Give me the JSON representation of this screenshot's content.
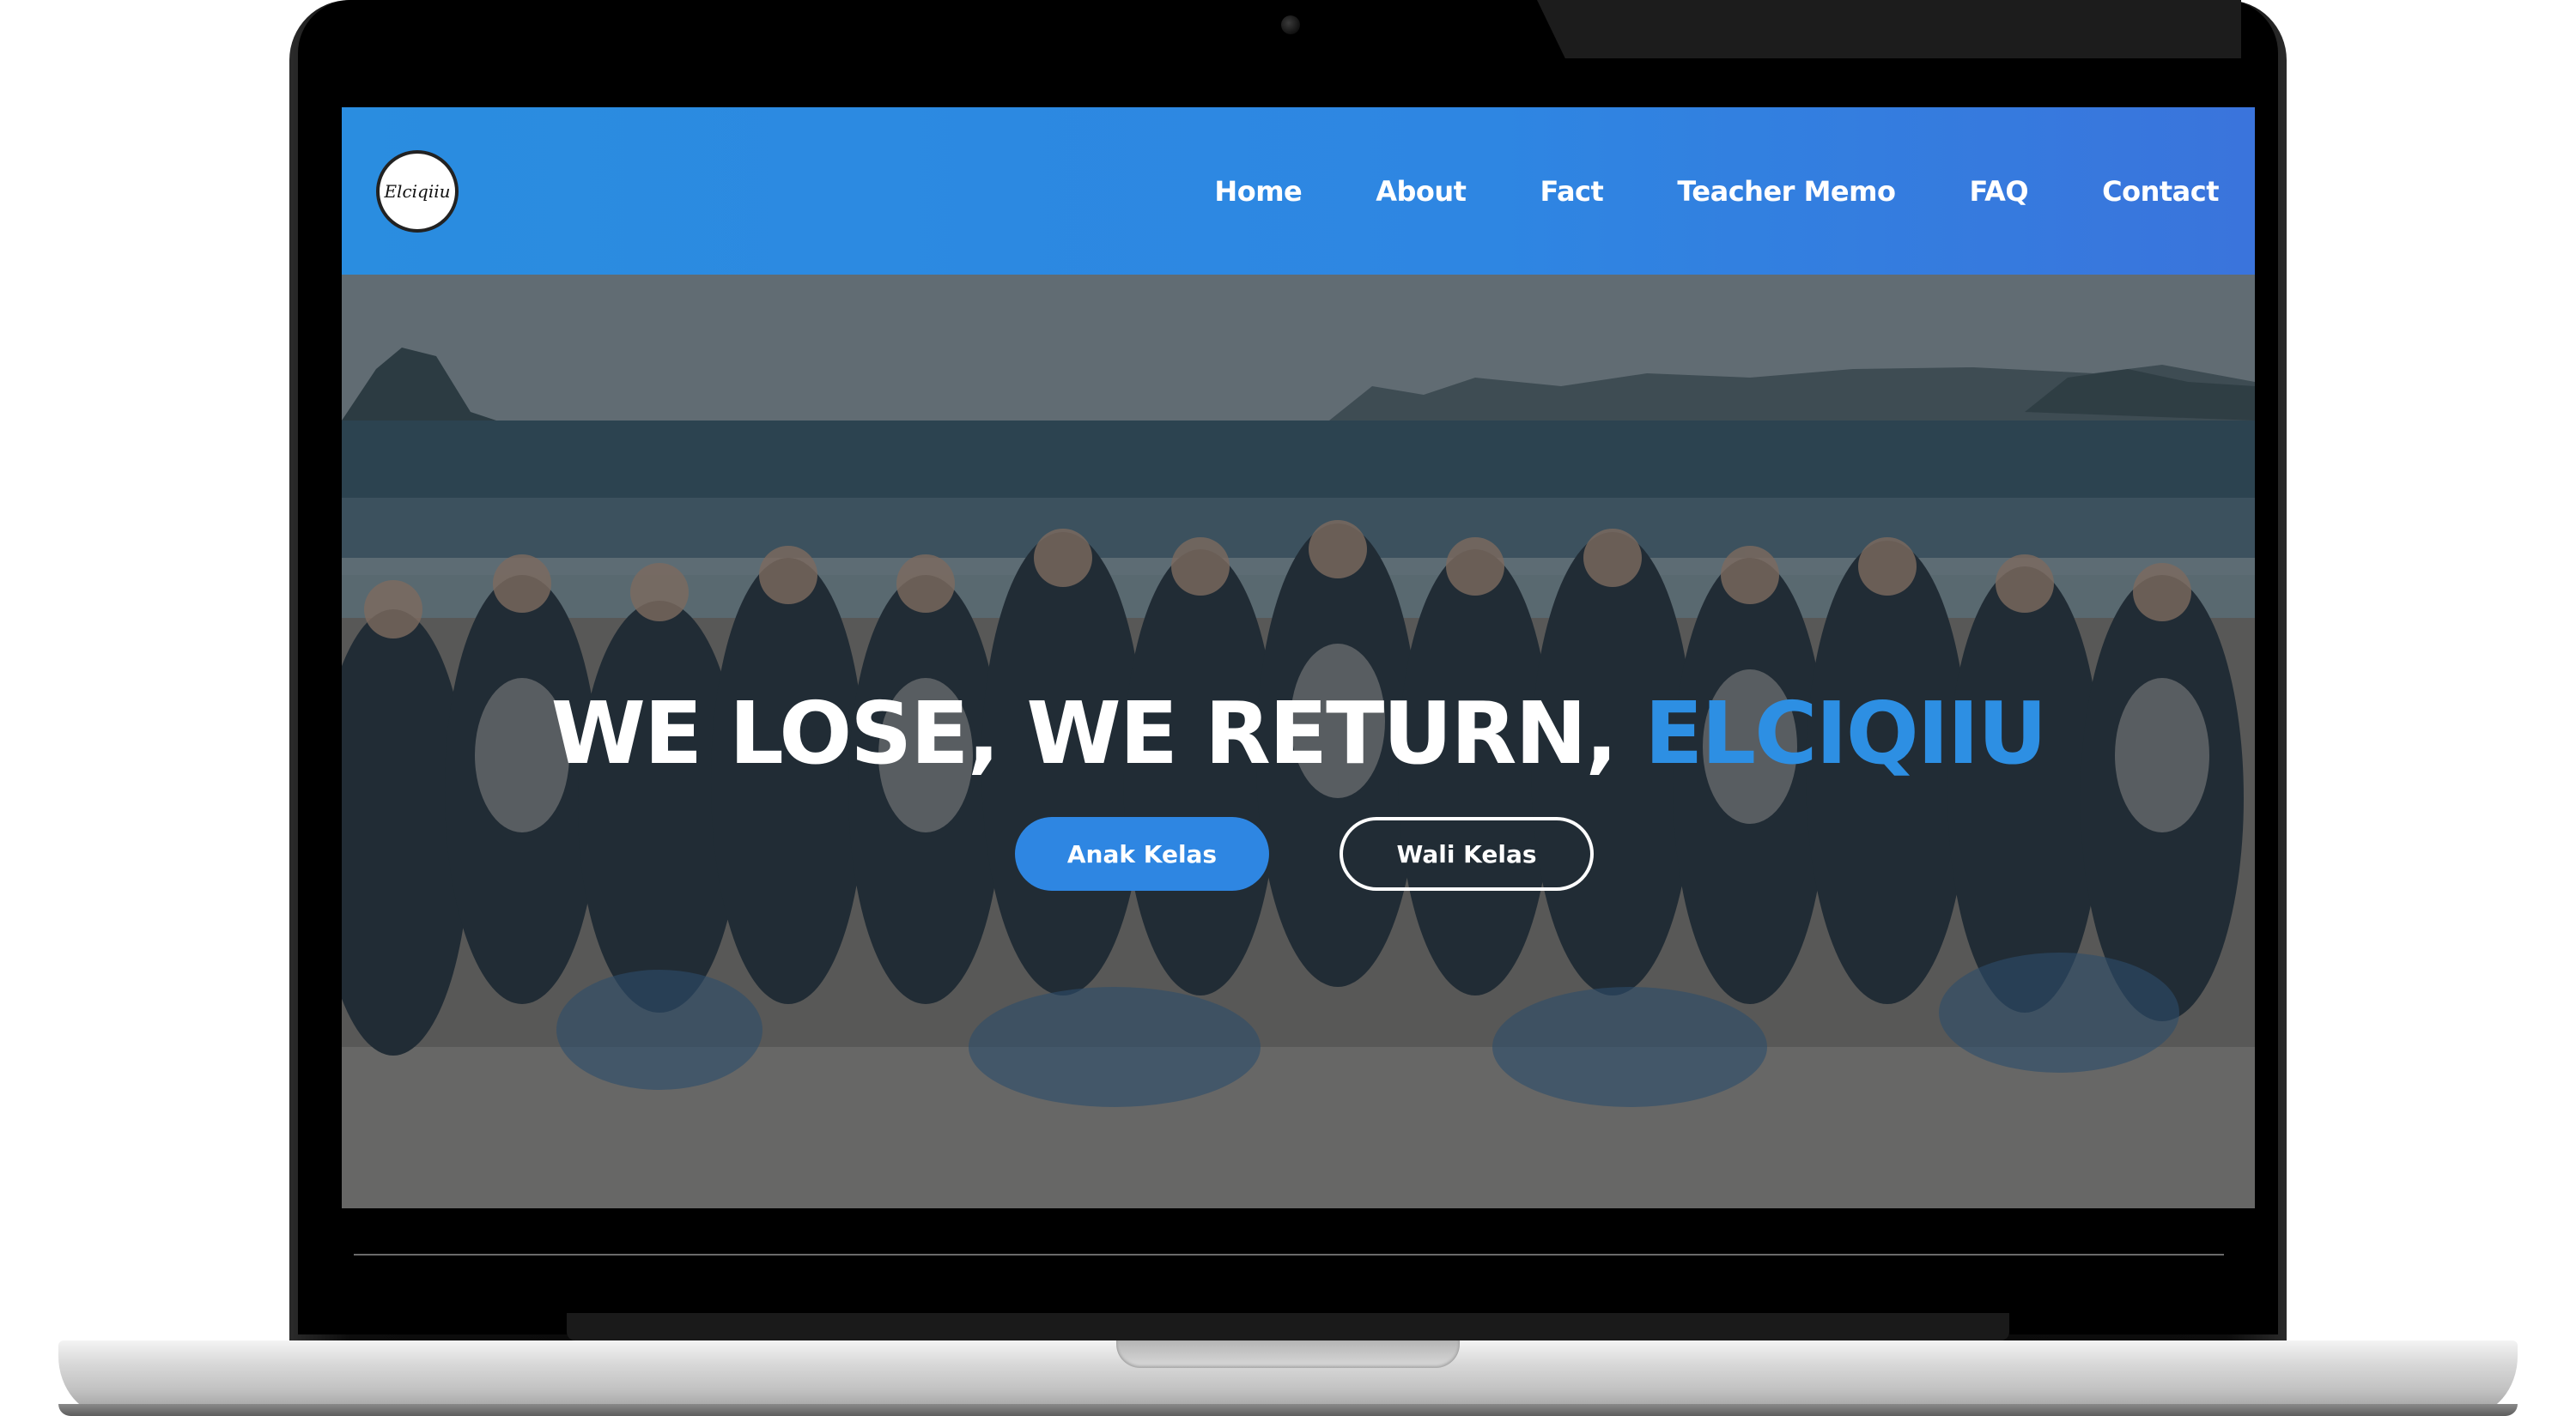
{
  "brand": {
    "logo_text": "Elciqiiu",
    "accent_color": "#2d8fe3",
    "navbar_color": "#2e86e2"
  },
  "nav": {
    "items": [
      {
        "label": "Home"
      },
      {
        "label": "About"
      },
      {
        "label": "Fact"
      },
      {
        "label": "Teacher Memo"
      },
      {
        "label": "FAQ"
      },
      {
        "label": "Contact"
      }
    ]
  },
  "hero": {
    "title_main": "WE LOSE, WE RETURN, ",
    "title_accent": "ELCIQIIU",
    "primary_button": "Anak Kelas",
    "secondary_button": "Wali Kelas",
    "background": "group-photo-on-beach"
  }
}
